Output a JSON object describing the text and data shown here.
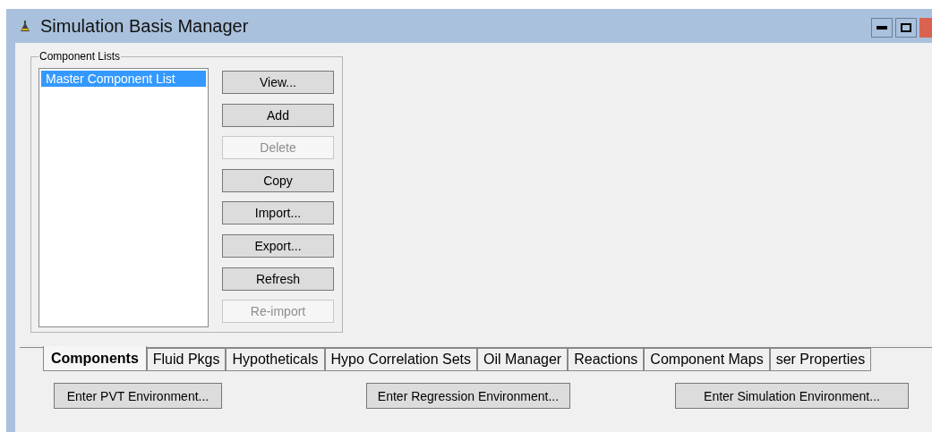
{
  "window": {
    "title": "Simulation Basis Manager"
  },
  "component_lists": {
    "label": "Component Lists",
    "items": [
      {
        "label": "Master Component List",
        "selected": true
      }
    ],
    "buttons": [
      {
        "label": "View...",
        "disabled": false
      },
      {
        "label": "Add",
        "disabled": false
      },
      {
        "label": "Delete",
        "disabled": true
      },
      {
        "label": "Copy",
        "disabled": false
      },
      {
        "label": "Import...",
        "disabled": false
      },
      {
        "label": "Export...",
        "disabled": false
      },
      {
        "label": "Refresh",
        "disabled": false
      },
      {
        "label": "Re-import",
        "disabled": true
      }
    ]
  },
  "tabs": [
    {
      "label": "Components",
      "selected": true
    },
    {
      "label": "Fluid Pkgs",
      "selected": false
    },
    {
      "label": "Hypotheticals",
      "selected": false
    },
    {
      "label": "Hypo Correlation Sets",
      "selected": false
    },
    {
      "label": "Oil Manager",
      "selected": false
    },
    {
      "label": "Reactions",
      "selected": false
    },
    {
      "label": "Component Maps",
      "selected": false
    },
    {
      "label": "ser Properties",
      "selected": false
    }
  ],
  "environment_buttons": [
    "Enter PVT Environment...",
    "Enter Regression Environment...",
    "Enter Simulation Environment..."
  ]
}
